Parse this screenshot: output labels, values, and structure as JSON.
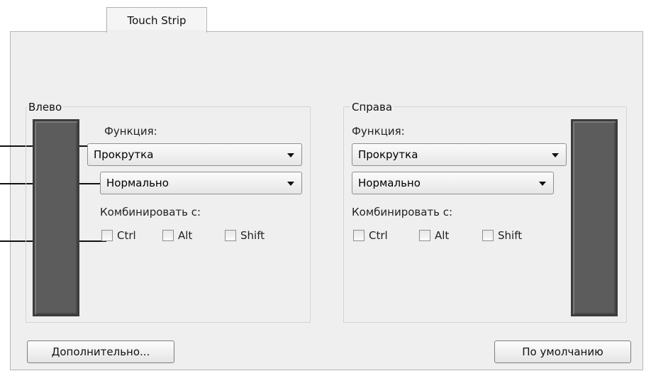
{
  "tabs": {
    "active": "Touch Strip"
  },
  "left": {
    "group_label": "Влево",
    "function_label": "Функция:",
    "function_value": "Прокрутка",
    "mode_value": "Нормально",
    "combine_label": "Комбинировать с:",
    "modifiers": [
      {
        "label": "Ctrl",
        "checked": false
      },
      {
        "label": "Alt",
        "checked": false
      },
      {
        "label": "Shift",
        "checked": false
      }
    ]
  },
  "right": {
    "group_label": "Справа",
    "function_label": "Функция:",
    "function_value": "Прокрутка",
    "mode_value": "Нормально",
    "combine_label": "Комбинировать с:",
    "modifiers": [
      {
        "label": "Ctrl",
        "checked": false
      },
      {
        "label": "Alt",
        "checked": false
      },
      {
        "label": "Shift",
        "checked": false
      }
    ]
  },
  "buttons": {
    "advanced": "Дополнительно...",
    "default": "По умолчанию"
  },
  "icons": {
    "dropdown": "chevron-down-icon",
    "checkbox": "checkbox-icon"
  }
}
